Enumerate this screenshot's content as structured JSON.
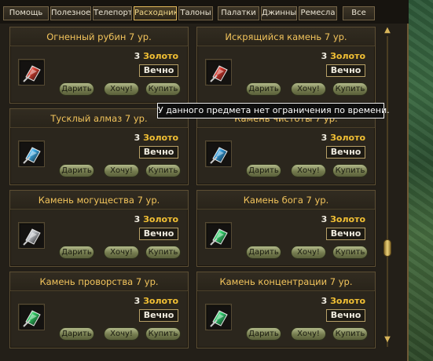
{
  "tabs": [
    {
      "label": "Помощь"
    },
    {
      "label": "Полезное"
    },
    {
      "label": "Телепорт"
    },
    {
      "label": "Расходники"
    },
    {
      "label": "Талоны"
    },
    {
      "label": "Палатки"
    },
    {
      "label": "Джинны"
    },
    {
      "label": "Ремесла"
    },
    {
      "label": "Все"
    }
  ],
  "active_tab": "Расходники",
  "items": [
    {
      "title": "Огненный рубин 7 ур.",
      "price": "3",
      "currency": "Золото",
      "duration": "Вечно",
      "gem_color": "#d43a2c",
      "icon": "red-gem-icon"
    },
    {
      "title": "Искрящийся камень 7 ур.",
      "price": "3",
      "currency": "Золото",
      "duration": "Вечно",
      "gem_color": "#d23026",
      "icon": "red-gem-icon"
    },
    {
      "title": "Тусклый алмаз 7 ур.",
      "price": "3",
      "currency": "Золото",
      "duration": "Вечно",
      "gem_color": "#39a9e6",
      "icon": "blue-gem-icon"
    },
    {
      "title": "Камень чистоты 7 ур.",
      "price": "3",
      "currency": "Золото",
      "duration": "Вечно",
      "gem_color": "#2c97d8",
      "icon": "blue-gem-icon"
    },
    {
      "title": "Камень могущества 7 ур.",
      "price": "3",
      "currency": "Золото",
      "duration": "Вечно",
      "gem_color": "#b9bcc2",
      "icon": "silver-gem-icon"
    },
    {
      "title": "Камень бога 7 ур.",
      "price": "3",
      "currency": "Золото",
      "duration": "Вечно",
      "gem_color": "#2fcf6a",
      "icon": "green-gem-icon"
    },
    {
      "title": "Камень проворства 7 ур.",
      "price": "3",
      "currency": "Золото",
      "duration": "Вечно",
      "gem_color": "#28c25c",
      "icon": "green-gem-icon"
    },
    {
      "title": "Камень концентрации 7 ур.",
      "price": "3",
      "currency": "Золото",
      "duration": "Вечно",
      "gem_color": "#2cc86a",
      "icon": "green-gem-icon"
    }
  ],
  "buttons": {
    "gift": "Дарить",
    "want": "Хочу!",
    "buy": "Купить"
  },
  "tooltip": "У данного предмета нет ограничения по времени.",
  "scrollbar": {
    "position_fraction": 0.72
  }
}
